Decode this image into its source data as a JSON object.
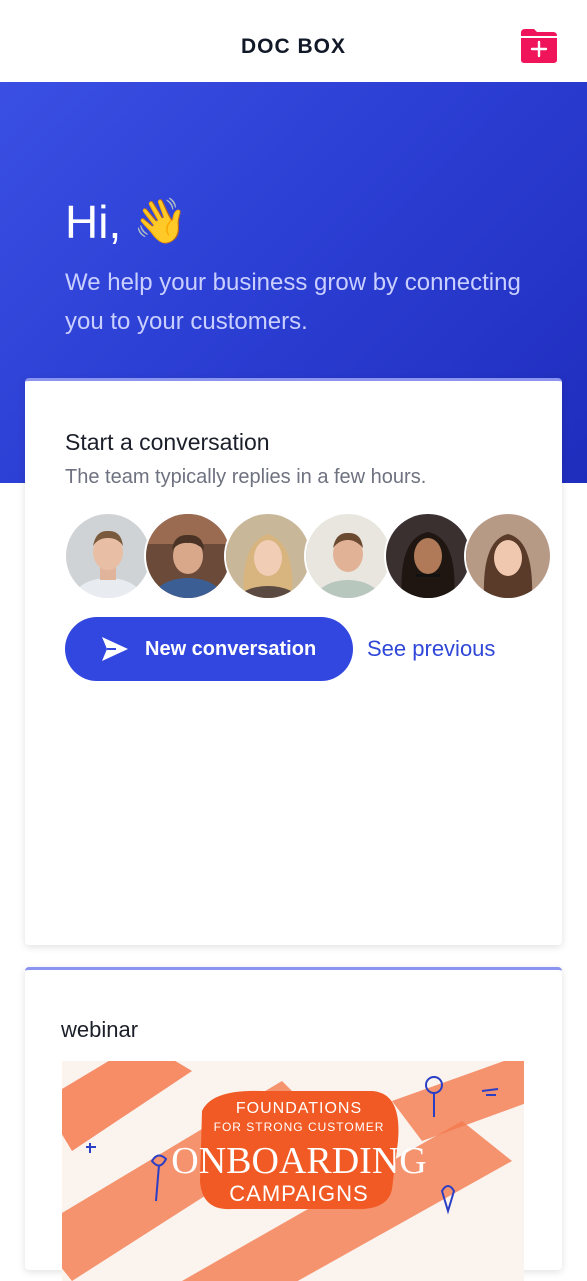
{
  "header": {
    "title": "DOC BOX",
    "action_icon": "folder-plus-icon",
    "accent_color": "#f0145a"
  },
  "hero": {
    "greeting": "Hi,",
    "emoji": "👋",
    "tagline": "We help your business grow by connecting you to your customers.",
    "gradient_start": "#3a4fe3",
    "gradient_end": "#1f2dbd"
  },
  "conversation_card": {
    "title": "Start a conversation",
    "subtitle": "The team typically replies in a few hours.",
    "avatars": [
      "team-member-1",
      "team-member-2",
      "team-member-3",
      "team-member-4",
      "team-member-5",
      "team-member-6"
    ],
    "new_button_label": "New conversation",
    "send_icon": "send-icon",
    "see_previous_label": "See previous",
    "button_color": "#3246e0"
  },
  "webinar_card": {
    "title": "webinar",
    "image": {
      "line1": "FOUNDATIONS",
      "line2": "FOR STRONG CUSTOMER",
      "line3": "ONBOARDING",
      "line4": "CAMPAIGNS",
      "badge_color": "#f15a24",
      "stripe_color": "#f47a4f"
    }
  }
}
